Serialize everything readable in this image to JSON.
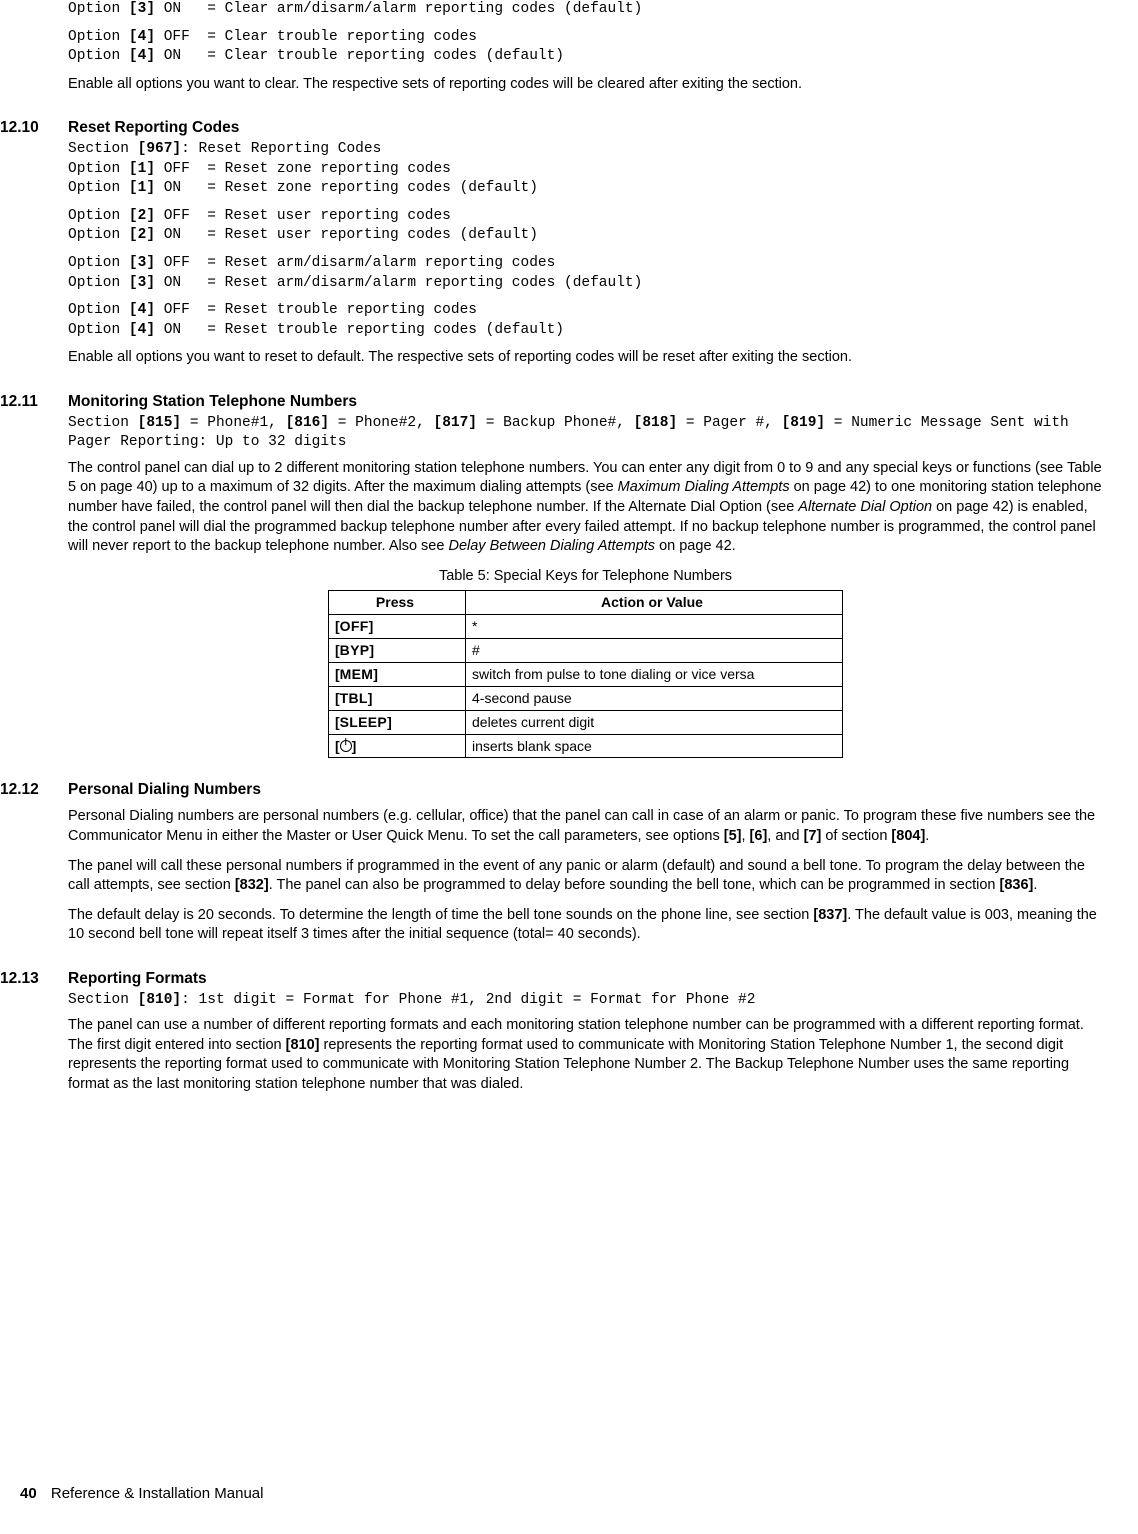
{
  "lead_in": {
    "opt3on": "Option [3] ON   = Clear arm/disarm/alarm reporting codes (default)",
    "opt4off": "Option [4] OFF  = Clear trouble reporting codes",
    "opt4on": "Option [4] ON   = Clear trouble reporting codes (default)",
    "note": "Enable all options you want to clear. The respective sets of reporting codes will be cleared after exiting the section."
  },
  "s12_10": {
    "num": "12.10",
    "title": "Reset Reporting Codes",
    "section_line": "Section [967]: Reset Reporting Codes",
    "opts": [
      "Option [1] OFF  = Reset zone reporting codes",
      "Option [1] ON   = Reset zone reporting codes (default)",
      "",
      "Option [2] OFF  = Reset user reporting codes",
      "Option [2] ON   = Reset user reporting codes (default)",
      "",
      "Option [3] OFF  = Reset arm/disarm/alarm reporting codes",
      "Option [3] ON   = Reset arm/disarm/alarm reporting codes (default)",
      "",
      "Option [4] OFF  = Reset trouble reporting codes",
      "Option [4] ON   = Reset trouble reporting codes (default)"
    ],
    "note": "Enable all options you want to reset to default. The respective sets of reporting codes will be reset after exiting the section."
  },
  "s12_11": {
    "num": "12.11",
    "title": "Monitoring Station Telephone Numbers",
    "section_line": "Section [815] = Phone#1, [816] = Phone#2, [817] = Backup Phone#, [818] = Pager #, [819] = Numeric Message Sent with Pager Reporting: Up to 32 digits",
    "para_pre": "The control panel can dial up to 2 different monitoring station telephone numbers. You can enter any digit from 0 to 9 and any special keys or functions (see Table 5 on page 40) up to a maximum of 32 digits. After the maximum dialing attempts (see ",
    "para_i1": "Maximum Dialing Attempts",
    "para_mid1": " on page 42) to one monitoring station telephone number have failed, the control panel will then dial the backup telephone number. If the Alternate Dial Option (see ",
    "para_i2": "Alternate Dial Option",
    "para_mid2": " on page 42) is enabled, the control panel will dial the programmed backup telephone number after every failed attempt. If no backup telephone number is programmed, the control panel will never report to the backup telephone number. Also see ",
    "para_i3": "Delay Between Dialing Attempts",
    "para_post": " on page 42.",
    "table_caption": "Table 5: Special Keys for Telephone Numbers",
    "th_press": "Press",
    "th_action": "Action or Value",
    "rows": [
      {
        "press": "[OFF]",
        "action": "*"
      },
      {
        "press": "[BYP]",
        "action": "#"
      },
      {
        "press": "[MEM]",
        "action": "switch from pulse to tone dialing or vice versa"
      },
      {
        "press": "[TBL]",
        "action": "4-second pause"
      },
      {
        "press": "[SLEEP]",
        "action": "deletes current digit"
      },
      {
        "press": "__POWER__",
        "action": "inserts blank space"
      }
    ]
  },
  "s12_12": {
    "num": "12.12",
    "title": "Personal Dialing Numbers",
    "p1_a": "Personal Dialing numbers are personal numbers (e.g. cellular, office) that the panel can call in case of an alarm or panic. To program these five numbers see the Communicator Menu in either the Master or User Quick Menu. To set the call parameters, see options ",
    "p1_b": "[5]",
    "p1_c": ", ",
    "p1_d": "[6]",
    "p1_e": ", and ",
    "p1_f": "[7]",
    "p1_g": " of section ",
    "p1_h": "[804]",
    "p1_i": ".",
    "p2_a": "The panel will call these personal numbers if programmed in the event of any panic or alarm (default) and sound a bell tone. To program the delay between the call attempts, see section ",
    "p2_b": "[832]",
    "p2_c": ". The panel can also be programmed to delay before sounding the bell tone, which can be programmed in section ",
    "p2_d": "[836]",
    "p2_e": ".",
    "p3_a": "The default delay is 20 seconds. To determine the length of time the bell tone sounds on the phone line, see section ",
    "p3_b": "[837]",
    "p3_c": ". The default value is 003, meaning the 10 second bell tone will repeat itself 3 times after the initial sequence (total= 40 seconds)."
  },
  "s12_13": {
    "num": "12.13",
    "title": "Reporting Formats",
    "section_line": "Section [810]: 1st digit = Format for Phone #1, 2nd digit = Format for Phone #2",
    "p1_a": "The panel can use a number of different reporting formats and each monitoring station telephone number can be programmed with a different reporting format. The first digit entered into section ",
    "p1_b": "[810]",
    "p1_c": " represents the reporting format used to communicate with Monitoring Station Telephone Number 1, the second digit represents the reporting format used to communicate with Monitoring Station Telephone Number 2. The Backup Telephone Number uses the same reporting format as the last monitoring station telephone number that was dialed."
  },
  "footer": {
    "page": "40",
    "title": "Reference & Installation Manual"
  }
}
